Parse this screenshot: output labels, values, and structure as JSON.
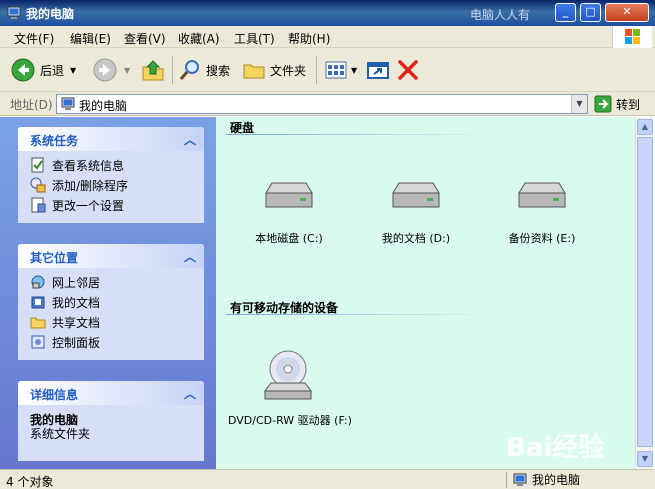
{
  "window": {
    "title": "我的电脑",
    "watermark_top": "电脑人人有"
  },
  "caption_buttons": {
    "minimize": "_",
    "maximize": "□",
    "close": "✕"
  },
  "menu": [
    "文件(F)",
    "编辑(E)",
    "查看(V)",
    "收藏(A)",
    "工具(T)",
    "帮助(H)"
  ],
  "toolbar": {
    "back": "后退",
    "search": "搜索",
    "folders": "文件夹"
  },
  "address": {
    "label": "地址(D)",
    "value": "我的电脑",
    "go": "转到"
  },
  "panels": {
    "system_tasks": {
      "title": "系统任务",
      "items": [
        "查看系统信息",
        "添加/删除程序",
        "更改一个设置"
      ]
    },
    "other_places": {
      "title": "其它位置",
      "items": [
        "网上邻居",
        "我的文档",
        "共享文档",
        "控制面板"
      ]
    },
    "details": {
      "title": "详细信息",
      "name": "我的电脑",
      "type": "系统文件夹"
    }
  },
  "groups": {
    "hard_disks": {
      "title": "硬盘",
      "drives": [
        "本地磁盘 (C:)",
        "我的文档 (D:)",
        "备份资料 (E:)"
      ]
    },
    "removable": {
      "title": "有可移动存储的设备",
      "drives": [
        "DVD/CD-RW 驱动器 (F:)"
      ]
    }
  },
  "watermark_baidu": "Bai经验",
  "status": {
    "count": "4 个对象",
    "location": "我的电脑"
  },
  "colors": {
    "title_bar": "#1c4fa0",
    "content_bg": "#d9fbee",
    "left_pane": "#7ba2e7",
    "panel_title": "#215dc6"
  }
}
